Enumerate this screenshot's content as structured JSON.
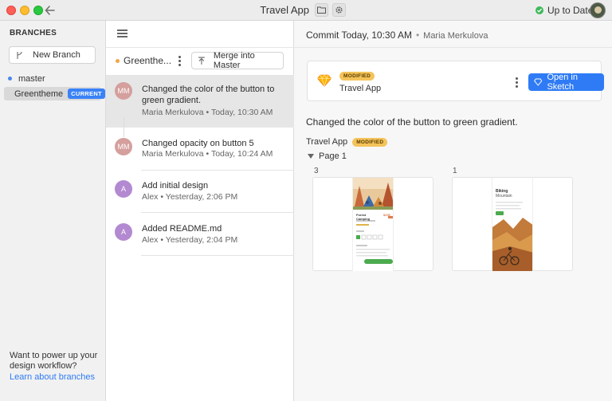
{
  "window": {
    "title": "Travel App",
    "status": "Up to Date"
  },
  "sidebar": {
    "section_label": "BRANCHES",
    "new_branch_label": "New Branch",
    "branches": [
      {
        "name": "master",
        "dot_color": "#4a86f0"
      },
      {
        "name": "Greentheme",
        "dot_color": "#f2a54a",
        "badge": "CURRENT"
      }
    ],
    "promo_text": "Want to power up your design workflow?",
    "promo_link": "Learn about branches"
  },
  "middle": {
    "branch_name": "Greenthe...",
    "merge_label": "Merge into Master",
    "commits": [
      {
        "initials": "MM",
        "title": "Changed the color of the button to green gradient.",
        "author": "Maria Merkulova",
        "time": "Today, 10:30 AM"
      },
      {
        "initials": "MM",
        "title": "Changed opacity on button 5",
        "author": "Maria Merkulova",
        "time": "Today, 10:24 AM"
      },
      {
        "initials": "A",
        "title": "Add initial design",
        "author": "Alex",
        "time": "Yesterday, 2:06 PM"
      },
      {
        "initials": "A",
        "title": "Added README.md",
        "author": "Alex",
        "time": "Yesterday, 2:04 PM"
      }
    ],
    "meta_separator": "•"
  },
  "detail": {
    "header_title": "Commit Today, 10:30 AM",
    "header_separator": "•",
    "header_author": "Maria Merkulova",
    "file_badge": "MODIFIED",
    "file_name": "Travel App",
    "open_button": "Open in Sketch",
    "commit_message": "Changed the color of the button to green gradient.",
    "doc_name": "Travel App",
    "doc_badge": "MODIFIED",
    "page_name": "Page 1",
    "artboards": [
      {
        "count": "3",
        "title": "Forest Camping",
        "price": "$250"
      },
      {
        "count": "1",
        "title": "Biking",
        "subtitle": "Mountain"
      }
    ]
  },
  "colors": {
    "accent": "#2f7bf5",
    "modified_badge": "#f4c35a",
    "status_ok": "#3fb85c"
  }
}
